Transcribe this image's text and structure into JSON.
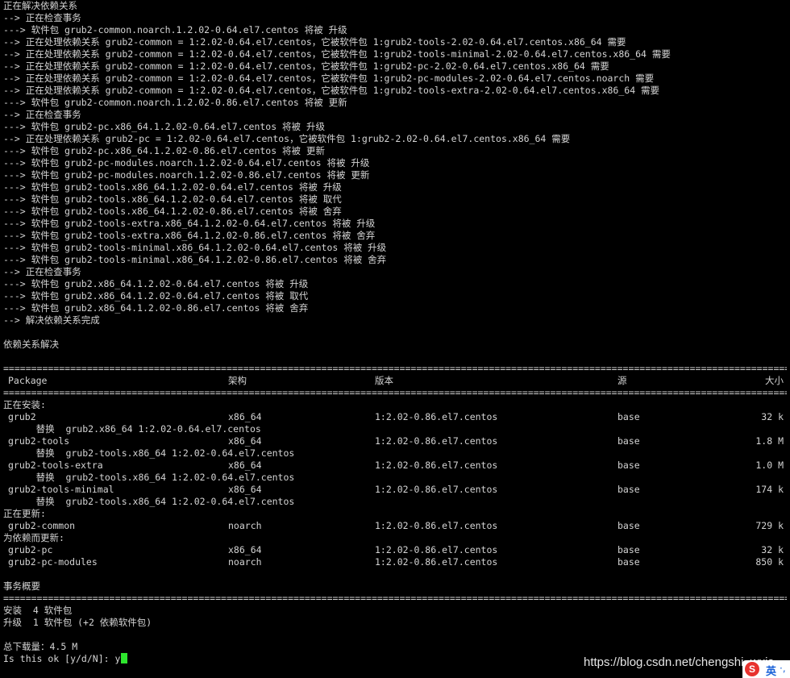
{
  "resolve_log": [
    "正在解决依赖关系",
    "--> 正在检查事务",
    "---> 软件包 grub2-common.noarch.1.2.02-0.64.el7.centos 将被 升级",
    "--> 正在处理依赖关系 grub2-common = 1:2.02-0.64.el7.centos，它被软件包 1:grub2-tools-2.02-0.64.el7.centos.x86_64 需要",
    "--> 正在处理依赖关系 grub2-common = 1:2.02-0.64.el7.centos，它被软件包 1:grub2-tools-minimal-2.02-0.64.el7.centos.x86_64 需要",
    "--> 正在处理依赖关系 grub2-common = 1:2.02-0.64.el7.centos，它被软件包 1:grub2-pc-2.02-0.64.el7.centos.x86_64 需要",
    "--> 正在处理依赖关系 grub2-common = 1:2.02-0.64.el7.centos，它被软件包 1:grub2-pc-modules-2.02-0.64.el7.centos.noarch 需要",
    "--> 正在处理依赖关系 grub2-common = 1:2.02-0.64.el7.centos，它被软件包 1:grub2-tools-extra-2.02-0.64.el7.centos.x86_64 需要",
    "---> 软件包 grub2-common.noarch.1.2.02-0.86.el7.centos 将被 更新",
    "--> 正在检查事务",
    "---> 软件包 grub2-pc.x86_64.1.2.02-0.64.el7.centos 将被 升级",
    "--> 正在处理依赖关系 grub2-pc = 1:2.02-0.64.el7.centos，它被软件包 1:grub2-2.02-0.64.el7.centos.x86_64 需要",
    "---> 软件包 grub2-pc.x86_64.1.2.02-0.86.el7.centos 将被 更新",
    "---> 软件包 grub2-pc-modules.noarch.1.2.02-0.64.el7.centos 将被 升级",
    "---> 软件包 grub2-pc-modules.noarch.1.2.02-0.86.el7.centos 将被 更新",
    "---> 软件包 grub2-tools.x86_64.1.2.02-0.64.el7.centos 将被 升级",
    "---> 软件包 grub2-tools.x86_64.1.2.02-0.64.el7.centos 将被 取代",
    "---> 软件包 grub2-tools.x86_64.1.2.02-0.86.el7.centos 将被 舍弃",
    "---> 软件包 grub2-tools-extra.x86_64.1.2.02-0.64.el7.centos 将被 升级",
    "---> 软件包 grub2-tools-extra.x86_64.1.2.02-0.86.el7.centos 将被 舍弃",
    "---> 软件包 grub2-tools-minimal.x86_64.1.2.02-0.64.el7.centos 将被 升级",
    "---> 软件包 grub2-tools-minimal.x86_64.1.2.02-0.86.el7.centos 将被 舍弃",
    "--> 正在检查事务",
    "---> 软件包 grub2.x86_64.1.2.02-0.64.el7.centos 将被 升级",
    "---> 软件包 grub2.x86_64.1.2.02-0.64.el7.centos 将被 取代",
    "---> 软件包 grub2.x86_64.1.2.02-0.86.el7.centos 将被 舍弃",
    "--> 解决依赖关系完成",
    "",
    "依赖关系解决",
    ""
  ],
  "table": {
    "headers": {
      "package": "Package",
      "arch": "架构",
      "version": "版本",
      "repo": "源",
      "size": "大小"
    },
    "installing_label": "正在安装:",
    "installing": [
      {
        "pkg": "grub2",
        "arch": "x86_64",
        "ver": "1:2.02-0.86.el7.centos",
        "repo": "base",
        "size": "32 k",
        "note": "     替换  grub2.x86_64 1:2.02-0.64.el7.centos"
      },
      {
        "pkg": "grub2-tools",
        "arch": "x86_64",
        "ver": "1:2.02-0.86.el7.centos",
        "repo": "base",
        "size": "1.8 M",
        "note": "     替换  grub2-tools.x86_64 1:2.02-0.64.el7.centos"
      },
      {
        "pkg": "grub2-tools-extra",
        "arch": "x86_64",
        "ver": "1:2.02-0.86.el7.centos",
        "repo": "base",
        "size": "1.0 M",
        "note": "     替换  grub2-tools.x86_64 1:2.02-0.64.el7.centos"
      },
      {
        "pkg": "grub2-tools-minimal",
        "arch": "x86_64",
        "ver": "1:2.02-0.86.el7.centos",
        "repo": "base",
        "size": "174 k",
        "note": "     替换  grub2-tools.x86_64 1:2.02-0.64.el7.centos"
      }
    ],
    "updating_label": "正在更新:",
    "updating": [
      {
        "pkg": "grub2-common",
        "arch": "noarch",
        "ver": "1:2.02-0.86.el7.centos",
        "repo": "base",
        "size": "729 k"
      }
    ],
    "dep_updating_label": "为依赖而更新:",
    "dep_updating": [
      {
        "pkg": "grub2-pc",
        "arch": "x86_64",
        "ver": "1:2.02-0.86.el7.centos",
        "repo": "base",
        "size": "32 k"
      },
      {
        "pkg": "grub2-pc-modules",
        "arch": "noarch",
        "ver": "1:2.02-0.86.el7.centos",
        "repo": "base",
        "size": "850 k"
      }
    ]
  },
  "summary": {
    "title": "事务概要",
    "install_line": "安装  4 软件包",
    "upgrade_line": "升级  1 软件包 (+2 依赖软件包)",
    "total_line": "总下载量：4.5 M",
    "prompt": "Is this ok [y/d/N]: ",
    "input": "y"
  },
  "watermark": "https://blog.csdn.net/chengshi_wxjs",
  "ime": {
    "logo": "S",
    "lang": "英",
    "punct": "·,"
  },
  "colors": {
    "background": "#000000",
    "text": "#d4d4d4",
    "cursor": "#2ee62e",
    "ime_red": "#e8322e"
  }
}
